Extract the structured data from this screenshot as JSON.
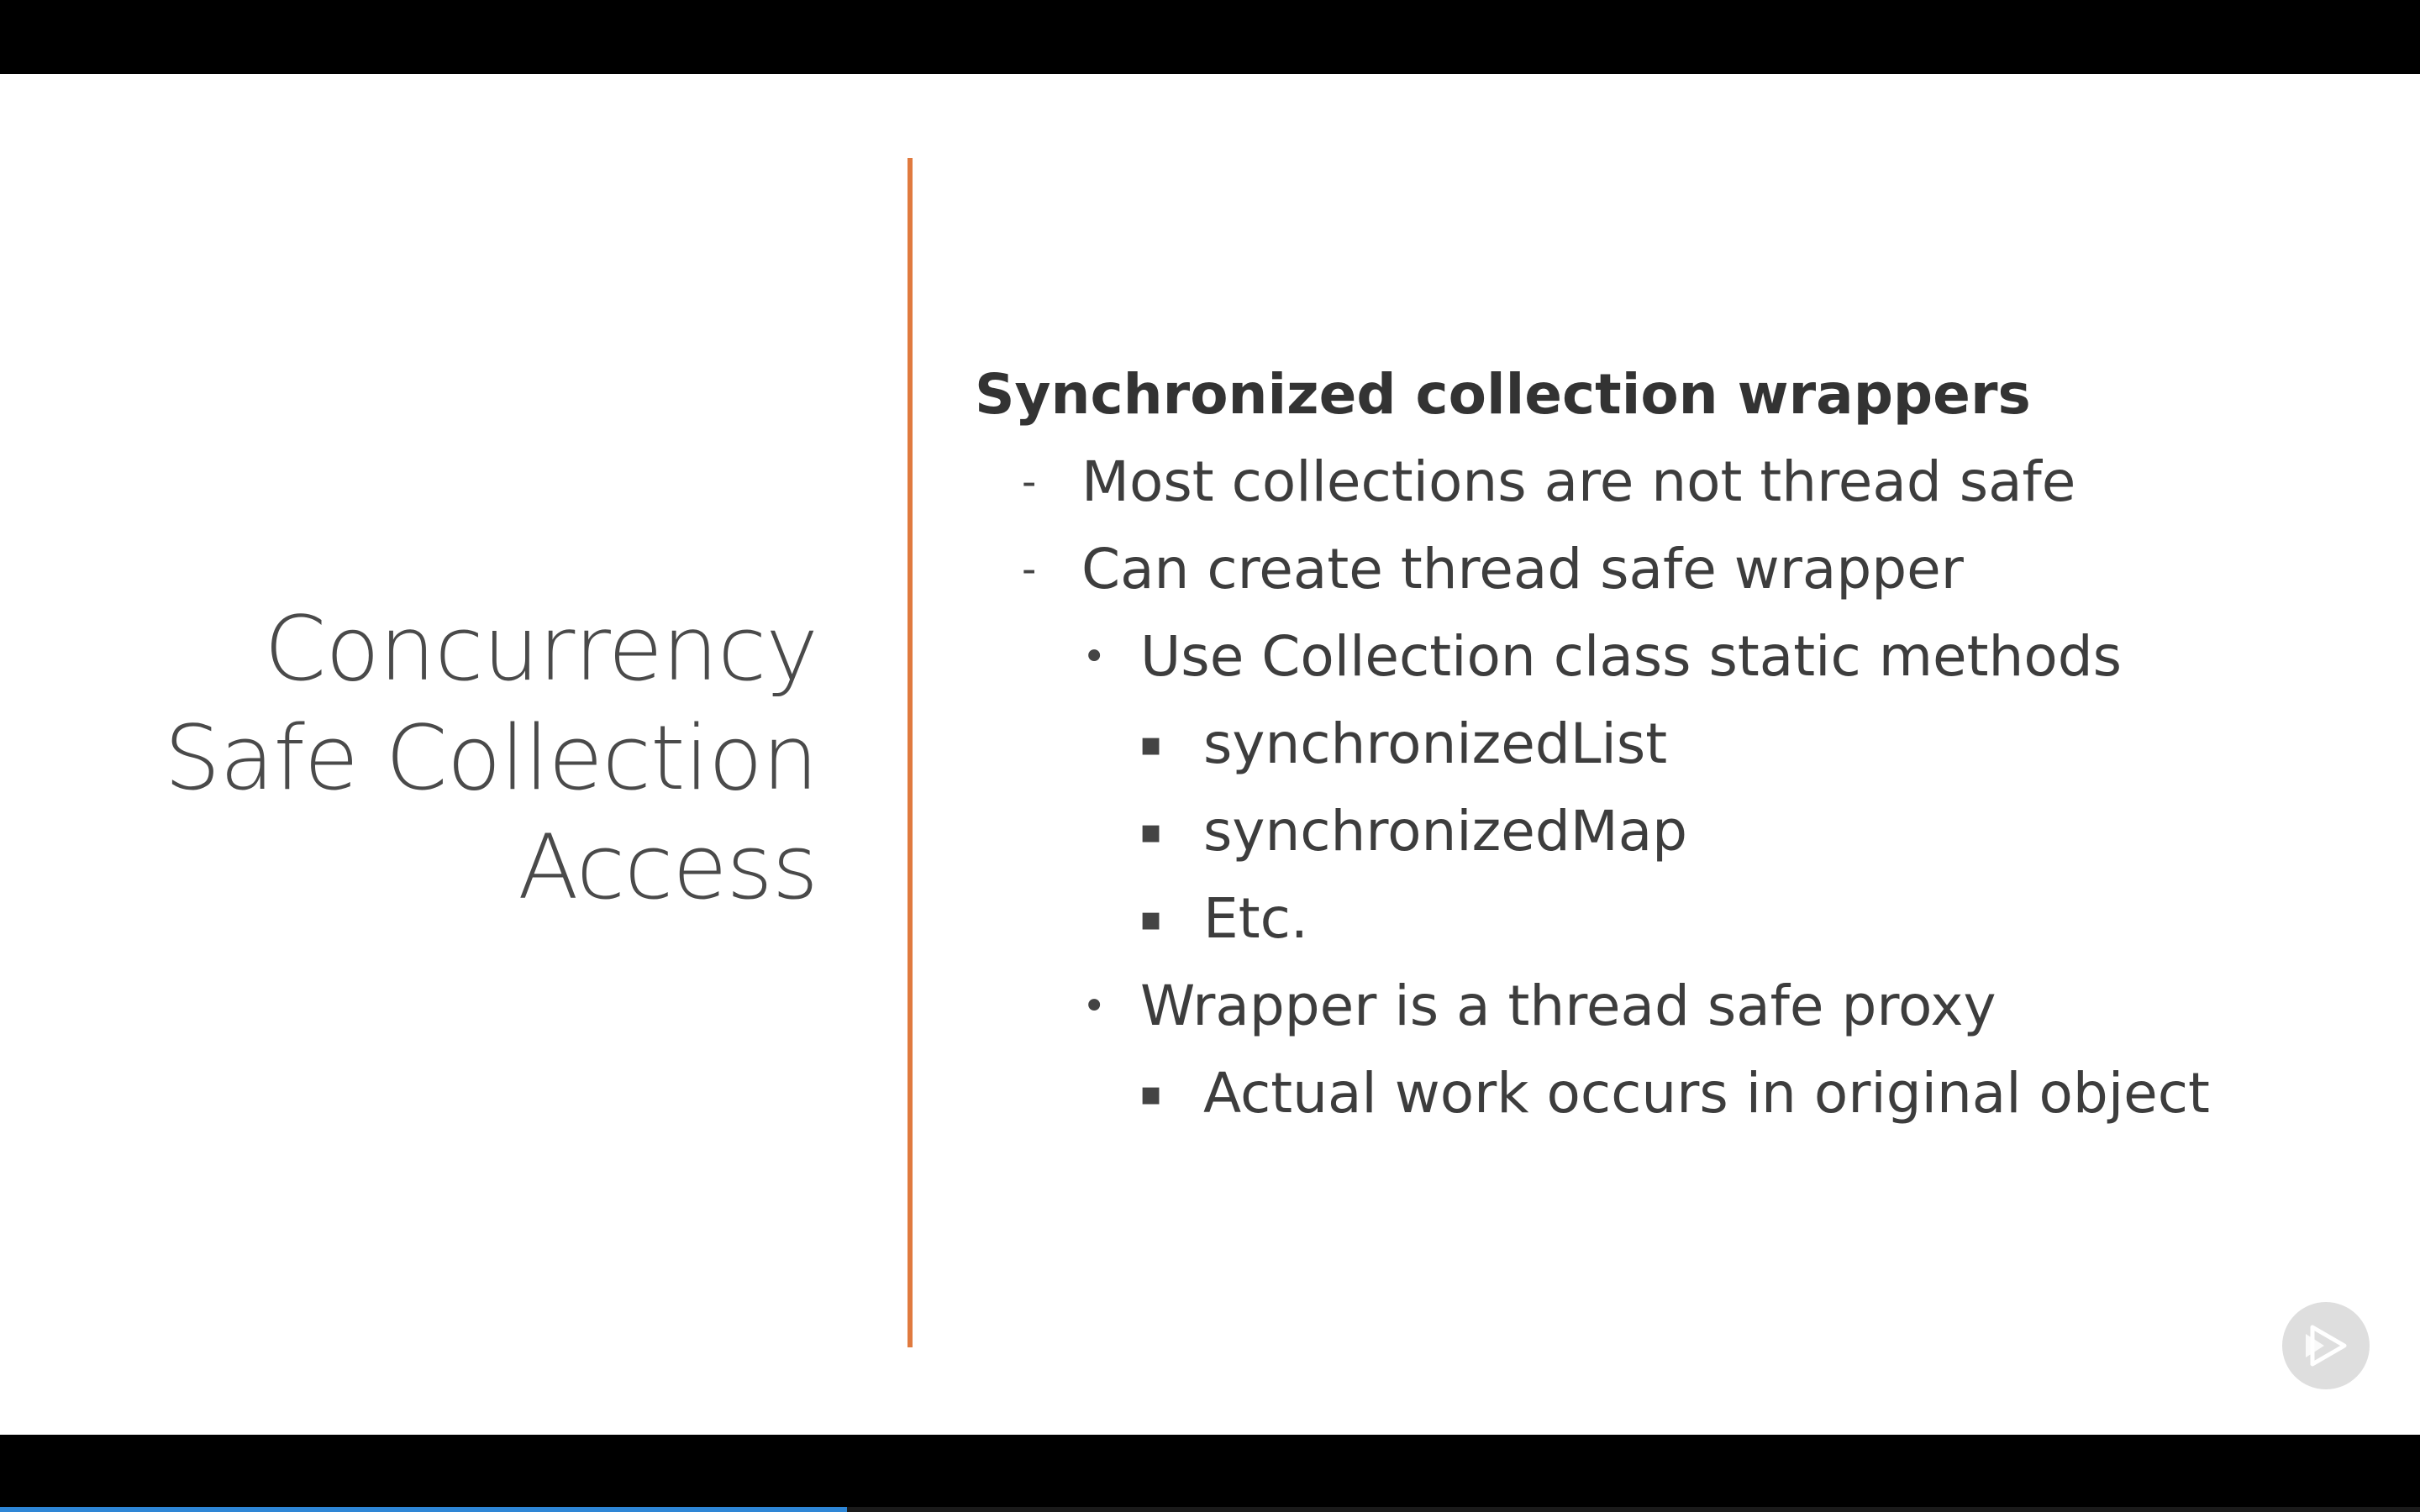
{
  "slide": {
    "title_lines": [
      "Concurrency",
      "Safe Collection",
      "Access"
    ],
    "heading": "Synchronized collection wrappers",
    "bullets": [
      {
        "level": 1,
        "marker": "-",
        "text": "Most collections are not thread safe"
      },
      {
        "level": 1,
        "marker": "-",
        "text": "Can create thread safe wrapper"
      },
      {
        "level": 2,
        "marker": "•",
        "text": "Use Collection class static methods"
      },
      {
        "level": 3,
        "marker": "▪",
        "text": "synchronizedList"
      },
      {
        "level": 3,
        "marker": "▪",
        "text": "synchronizedMap"
      },
      {
        "level": 3,
        "marker": "▪",
        "text": "Etc."
      },
      {
        "level": 2,
        "marker": "•",
        "text": "Wrapper is a thread safe proxy"
      },
      {
        "level": 3,
        "marker": "▪",
        "text": "Actual work occurs in original object"
      }
    ]
  },
  "player": {
    "progress_fraction": 0.35,
    "play_icon": "play-icon",
    "colors": {
      "accent": "#e07a3f",
      "progress": "#2e86d6"
    }
  }
}
